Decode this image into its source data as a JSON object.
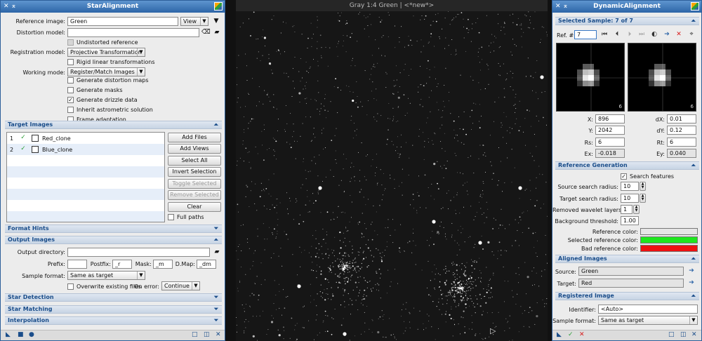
{
  "star_alignment": {
    "title": "StarAlignment",
    "reference_image_label": "Reference image:",
    "reference_image_value": "Green",
    "reference_view_option": "View",
    "distortion_model_label": "Distortion model:",
    "distortion_model_value": "",
    "undistorted_reference": "Undistorted reference",
    "registration_model_label": "Registration model:",
    "registration_model_value": "Projective Transformation",
    "rigid_transformations": "Rigid linear transformations",
    "working_mode_label": "Working mode:",
    "working_mode_value": "Register/Match Images",
    "options": [
      {
        "label": "Generate distortion maps",
        "checked": false
      },
      {
        "label": "Generate masks",
        "checked": false
      },
      {
        "label": "Generate drizzle data",
        "checked": true
      },
      {
        "label": "Inherit astrometric solution",
        "checked": false
      },
      {
        "label": "Frame adaptation",
        "checked": false
      }
    ],
    "target_images_section": "Target Images",
    "targets": [
      {
        "index": "1",
        "name": "Red_clone"
      },
      {
        "index": "2",
        "name": "Blue_clone"
      }
    ],
    "buttons": {
      "add_files": "Add Files",
      "add_views": "Add Views",
      "select_all": "Select All",
      "invert_selection": "Invert Selection",
      "toggle_selected": "Toggle Selected",
      "remove_selected": "Remove Selected",
      "clear": "Clear"
    },
    "full_paths": "Full paths",
    "format_hints_section": "Format Hints",
    "output_images_section": "Output Images",
    "output_directory_label": "Output directory:",
    "output_directory_value": "",
    "prefix_label": "Prefix:",
    "prefix_value": "",
    "postfix_label": "Postfix:",
    "postfix_value": "_r",
    "mask_label": "Mask:",
    "mask_value": "_m",
    "dmap_label": "D.Map:",
    "dmap_value": "_dm",
    "sample_format_label": "Sample format:",
    "sample_format_value": "Same as target",
    "overwrite_label": "Overwrite existing files",
    "on_error_label": "On error:",
    "on_error_value": "Continue",
    "star_detection_section": "Star Detection",
    "star_matching_section": "Star Matching",
    "interpolation_section": "Interpolation"
  },
  "image_window": {
    "title": "Gray 1:4 Green | <*new*>"
  },
  "dynamic_alignment": {
    "title": "DynamicAlignment",
    "selected_sample_section": "Selected Sample: 7 of 7",
    "ref_label": "Ref. #:",
    "ref_value": "7",
    "preview_left_number": "6",
    "preview_right_number": "6",
    "x_label": "X:",
    "x_value": "896",
    "y_label": "Y:",
    "y_value": "2042",
    "rs_label": "Rs:",
    "rs_value": "6",
    "ex_label": "Ex:",
    "ex_value": "-0.018",
    "dx_label": "dX:",
    "dx_value": "0.01",
    "dy_label": "dY:",
    "dy_value": "0.12",
    "rt_label": "Rt:",
    "rt_value": "6",
    "ey_label": "Ey:",
    "ey_value": "0.040",
    "reference_generation_section": "Reference Generation",
    "search_features": "Search features",
    "source_search_radius_label": "Source search radius:",
    "source_search_radius_value": "10",
    "target_search_radius_label": "Target search radius:",
    "target_search_radius_value": "10",
    "removed_wavelet_layers_label": "Removed wavelet layers:",
    "removed_wavelet_layers_value": "1",
    "background_threshold_label": "Background threshold:",
    "background_threshold_value": "1.00",
    "reference_color_label": "Reference color:",
    "selected_reference_color_label": "Selected reference color:",
    "bad_reference_color_label": "Bad reference color:",
    "colors": {
      "reference": "#e6e6e6",
      "selected_reference": "#1ee61e",
      "bad_reference": "#ee1111"
    },
    "aligned_images_section": "Aligned Images",
    "source_label": "Source:",
    "source_value": "Green",
    "target_label": "Target:",
    "target_value": "Red",
    "registered_image_section": "Registered Image",
    "identifier_label": "Identifier:",
    "identifier_value": "<Auto>",
    "sample_format_label": "Sample format:",
    "sample_format_value": "Same as target"
  }
}
